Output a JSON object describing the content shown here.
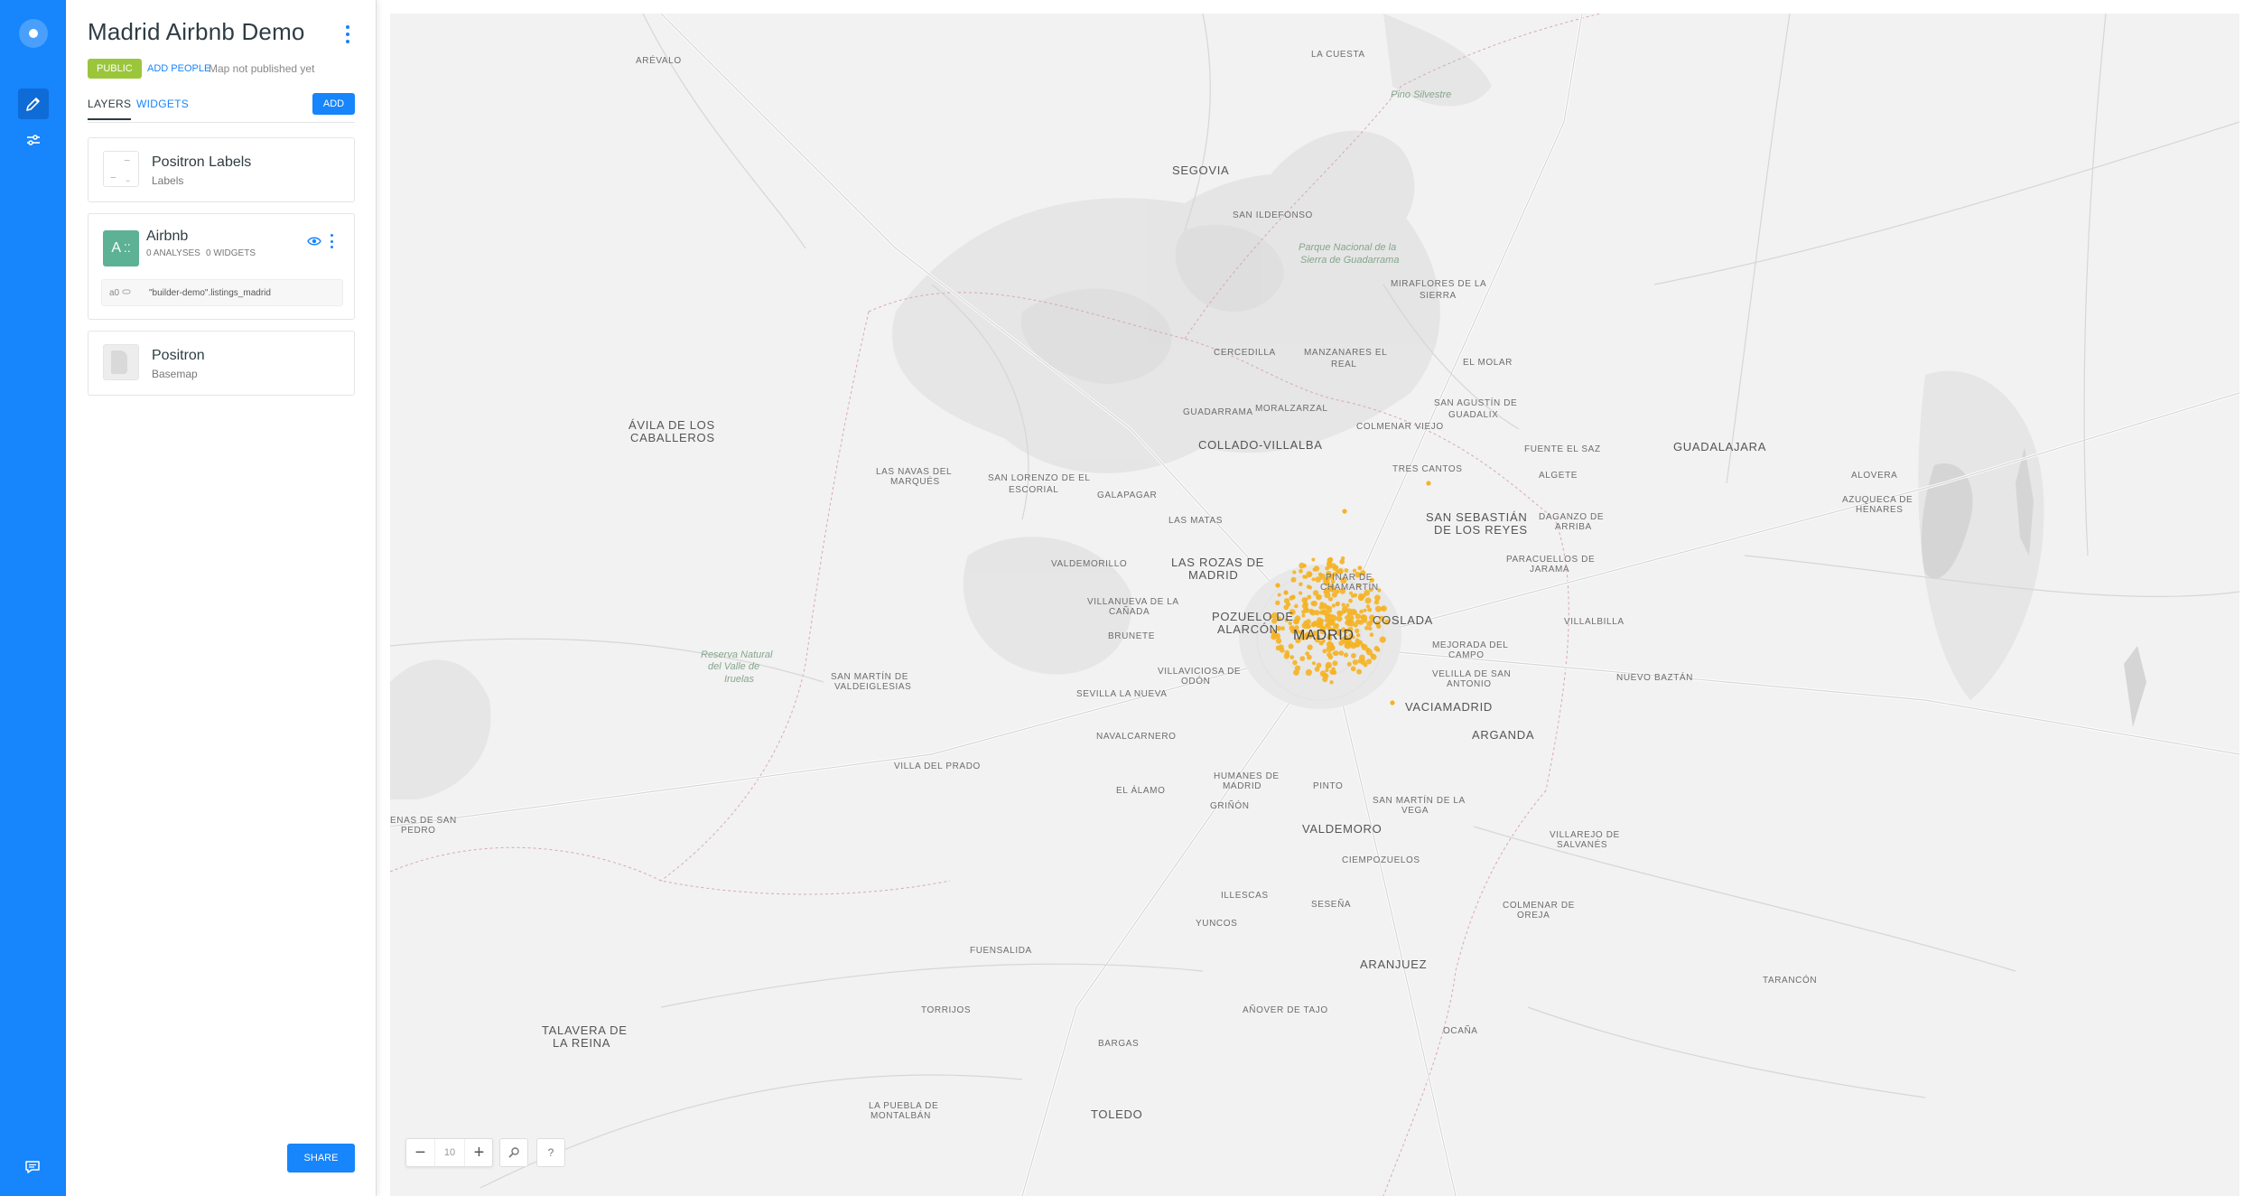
{
  "app": {
    "rail": {
      "logo_icon": "carto-logo-icon",
      "items": [
        {
          "icon": "pencil-icon",
          "active": true
        },
        {
          "icon": "sliders-icon",
          "active": false
        }
      ],
      "footer_icon": "chat-icon",
      "accent": "#1785FB"
    }
  },
  "panel": {
    "title": "Madrid Airbnb Demo",
    "privacy_badge": "PUBLIC",
    "add_people": "ADD PEOPLE",
    "publish_status": "Map not published yet",
    "tabs": [
      {
        "label": "LAYERS",
        "active": true
      },
      {
        "label": "WIDGETS",
        "active": false
      }
    ],
    "add_label": "ADD",
    "layers": [
      {
        "name": "Positron Labels",
        "subtitle": "Labels"
      },
      {
        "name": "Airbnb",
        "letter": "A",
        "analyses": "0 ANALYSES",
        "widgets": "0 WIDGETS",
        "source_id": "a0",
        "source_name": "\"builder-demo\".listings_madrid",
        "color": "#5DB194"
      },
      {
        "name": "Positron",
        "subtitle": "Basemap"
      }
    ],
    "share_label": "SHARE"
  },
  "map": {
    "zoom_level": "10",
    "help_label": "?",
    "point_color": "#F5B324",
    "labels": [
      {
        "text": "ARÉVALO",
        "cls": "lbl"
      },
      {
        "text": "LA CUESTA",
        "cls": "lbl"
      },
      {
        "text": "Pino Silvestre",
        "cls": "lbl-park"
      },
      {
        "text": "SEGOVIA",
        "cls": "lbl lbl-city"
      },
      {
        "text": "SAN ILDEFONSO",
        "cls": "lbl"
      },
      {
        "text": "Parque Nacional de la",
        "cls": "lbl-park"
      },
      {
        "text": "Sierra de Guadarrama",
        "cls": "lbl-park"
      },
      {
        "text": "MIRAFLORES DE LA",
        "cls": "lbl"
      },
      {
        "text": "SIERRA",
        "cls": "lbl"
      },
      {
        "text": "CERCEDILLA",
        "cls": "lbl"
      },
      {
        "text": "MANZANARES EL",
        "cls": "lbl"
      },
      {
        "text": "REAL",
        "cls": "lbl"
      },
      {
        "text": "EL MOLAR",
        "cls": "lbl"
      },
      {
        "text": "GUADARRAMA",
        "cls": "lbl"
      },
      {
        "text": "MORALZARZAL",
        "cls": "lbl"
      },
      {
        "text": "SAN AGUSTÍN DE",
        "cls": "lbl"
      },
      {
        "text": "GUADALIX",
        "cls": "lbl"
      },
      {
        "text": "COLMENAR VIEJO",
        "cls": "lbl"
      },
      {
        "text": "ÁVILA DE LOS",
        "cls": "lbl lbl-city"
      },
      {
        "text": "CABALLEROS",
        "cls": "lbl lbl-city"
      },
      {
        "text": "COLLADO-VILLALBA",
        "cls": "lbl lbl-city"
      },
      {
        "text": "FUENTE EL SAZ",
        "cls": "lbl"
      },
      {
        "text": "GUADALAJARA",
        "cls": "lbl lbl-city"
      },
      {
        "text": "TRES CANTOS",
        "cls": "lbl"
      },
      {
        "text": "ALGETE",
        "cls": "lbl"
      },
      {
        "text": "ALOVERA",
        "cls": "lbl"
      },
      {
        "text": "LAS NAVAS DEL",
        "cls": "lbl"
      },
      {
        "text": "MARQUÉS",
        "cls": "lbl"
      },
      {
        "text": "SAN LORENZO DE EL",
        "cls": "lbl"
      },
      {
        "text": "ESCORIAL",
        "cls": "lbl"
      },
      {
        "text": "GALAPAGAR",
        "cls": "lbl"
      },
      {
        "text": "AZUQUECA DE",
        "cls": "lbl"
      },
      {
        "text": "HENARES",
        "cls": "lbl"
      },
      {
        "text": "LAS MATAS",
        "cls": "lbl"
      },
      {
        "text": "SAN SEBASTIÁN",
        "cls": "lbl lbl-city"
      },
      {
        "text": "DE LOS REYES",
        "cls": "lbl lbl-city"
      },
      {
        "text": "DAGANZO DE",
        "cls": "lbl"
      },
      {
        "text": "ARRIBA",
        "cls": "lbl"
      },
      {
        "text": "VALDEMORILLO",
        "cls": "lbl"
      },
      {
        "text": "LAS ROZAS DE",
        "cls": "lbl lbl-city"
      },
      {
        "text": "MADRID",
        "cls": "lbl lbl-city"
      },
      {
        "text": "PARACUELLOS DE",
        "cls": "lbl"
      },
      {
        "text": "JARAMA",
        "cls": "lbl"
      },
      {
        "text": "PINAR DE",
        "cls": "lbl"
      },
      {
        "text": "CHAMARTÍN",
        "cls": "lbl"
      },
      {
        "text": "VILLANUEVA DE LA",
        "cls": "lbl"
      },
      {
        "text": "CAÑADA",
        "cls": "lbl"
      },
      {
        "text": "POZUELO DE",
        "cls": "lbl lbl-city"
      },
      {
        "text": "ALARCÓN",
        "cls": "lbl lbl-city"
      },
      {
        "text": "COSLADA",
        "cls": "lbl lbl-city"
      },
      {
        "text": "VILLALBILLA",
        "cls": "lbl"
      },
      {
        "text": "BRUNETE",
        "cls": "lbl"
      },
      {
        "text": "MADRID",
        "cls": "lbl lbl-big"
      },
      {
        "text": "MEJORADA DEL",
        "cls": "lbl"
      },
      {
        "text": "CAMPO",
        "cls": "lbl"
      },
      {
        "text": "Reserva Natural",
        "cls": "lbl-park"
      },
      {
        "text": "del Valle de",
        "cls": "lbl-park"
      },
      {
        "text": "Iruelas",
        "cls": "lbl-park"
      },
      {
        "text": "SAN MARTÍN DE",
        "cls": "lbl"
      },
      {
        "text": "VALDEIGLESIAS",
        "cls": "lbl"
      },
      {
        "text": "VILLAVICIOSA DE",
        "cls": "lbl"
      },
      {
        "text": "ODÓN",
        "cls": "lbl"
      },
      {
        "text": "VELILLA DE SAN",
        "cls": "lbl"
      },
      {
        "text": "ANTONIO",
        "cls": "lbl"
      },
      {
        "text": "NUEVO BAZTÁN",
        "cls": "lbl"
      },
      {
        "text": "SEVILLA LA NUEVA",
        "cls": "lbl"
      },
      {
        "text": "VACIAMADRID",
        "cls": "lbl lbl-city"
      },
      {
        "text": "ARGANDA",
        "cls": "lbl lbl-city"
      },
      {
        "text": "NAVALCARNERO",
        "cls": "lbl"
      },
      {
        "text": "VILLA DEL PRADO",
        "cls": "lbl"
      },
      {
        "text": "HUMANES DE",
        "cls": "lbl"
      },
      {
        "text": "MADRID",
        "cls": "lbl"
      },
      {
        "text": "PINTO",
        "cls": "lbl"
      },
      {
        "text": "EL ÁLAMO",
        "cls": "lbl"
      },
      {
        "text": "SAN MARTÍN DE LA",
        "cls": "lbl"
      },
      {
        "text": "VEGA",
        "cls": "lbl"
      },
      {
        "text": "GRIÑÓN",
        "cls": "lbl"
      },
      {
        "text": "ENAS DE SAN",
        "cls": "lbl"
      },
      {
        "text": "PEDRO",
        "cls": "lbl"
      },
      {
        "text": "VALDEMORO",
        "cls": "lbl lbl-city"
      },
      {
        "text": "VILLAREJO DE",
        "cls": "lbl"
      },
      {
        "text": "SALVANÉS",
        "cls": "lbl"
      },
      {
        "text": "CIEMPOZUELOS",
        "cls": "lbl"
      },
      {
        "text": "ILLESCAS",
        "cls": "lbl"
      },
      {
        "text": "SESEÑA",
        "cls": "lbl"
      },
      {
        "text": "COLMENAR DE",
        "cls": "lbl"
      },
      {
        "text": "OREJA",
        "cls": "lbl"
      },
      {
        "text": "YUNCOS",
        "cls": "lbl"
      },
      {
        "text": "FUENSALIDA",
        "cls": "lbl"
      },
      {
        "text": "ARANJUEZ",
        "cls": "lbl lbl-city"
      },
      {
        "text": "TARANCÓN",
        "cls": "lbl"
      },
      {
        "text": "TORRIJOS",
        "cls": "lbl"
      },
      {
        "text": "AÑOVER DE TAJO",
        "cls": "lbl"
      },
      {
        "text": "TALAVERA DE",
        "cls": "lbl lbl-city"
      },
      {
        "text": "LA REINA",
        "cls": "lbl lbl-city"
      },
      {
        "text": "OCAÑA",
        "cls": "lbl"
      },
      {
        "text": "BARGAS",
        "cls": "lbl"
      },
      {
        "text": "LA PUEBLA DE",
        "cls": "lbl"
      },
      {
        "text": "MONTALBÁN",
        "cls": "lbl"
      },
      {
        "text": "TOLEDO",
        "cls": "lbl lbl-city"
      }
    ]
  }
}
